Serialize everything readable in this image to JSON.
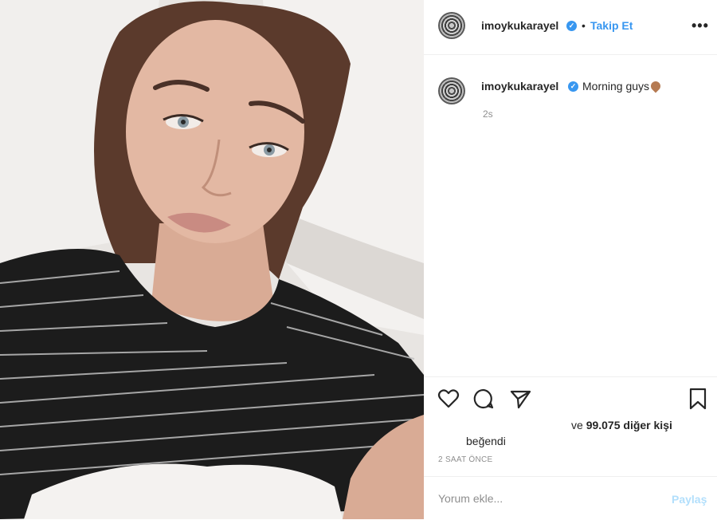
{
  "post": {
    "username": "imoykukarayel",
    "follow_label": "Takip Et",
    "separator": "•",
    "more_label": "•••",
    "caption": "Morning guys",
    "caption_time": "2s",
    "likes_prefix": "ve",
    "likes_count": "99.075 diğer kişi",
    "liked_label": "beğendi",
    "time_ago": "2 SAAT ÖNCE",
    "comment_placeholder": "Yorum ekle...",
    "share_label": "Paylaş"
  },
  "icons": {
    "like": "heart-icon",
    "comment": "comment-icon",
    "share": "send-icon",
    "save": "bookmark-icon",
    "verified": "verified-badge-icon",
    "more": "more-options-icon"
  },
  "colors": {
    "link_blue": "#3897f0",
    "muted": "#8e8e8e",
    "share_disabled": "#b2dffc",
    "text": "#262626"
  }
}
